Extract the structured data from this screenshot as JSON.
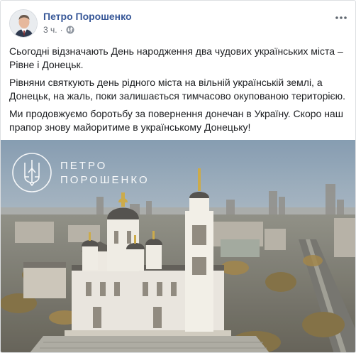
{
  "post": {
    "author": "Петро Порошенко",
    "time": "3 ч.",
    "separator": "·",
    "privacy_icon": "globe-icon",
    "more_icon": "more-options-icon",
    "paragraphs": [
      "Сьогодні відзначають День народження два чудових українських міста – Рівне і Донецьк.",
      "Рівняни святкують день рідного міста на вільній українській землі, а Донецьк, на жаль, поки залишається тимчасово окупованою територією.",
      "Ми продовжуємо боротьбу за повернення донечан в Україну. Скоро наш прапор знову майоритиме в українському Донецьку!"
    ],
    "photo": {
      "watermark_line1": "ПЕТРО",
      "watermark_line2": "ПОРОШЕНКО",
      "watermark_icon": "trident-icon"
    }
  },
  "colors": {
    "author_link": "#385898",
    "meta_text": "#616770",
    "border": "#dddfe2"
  }
}
